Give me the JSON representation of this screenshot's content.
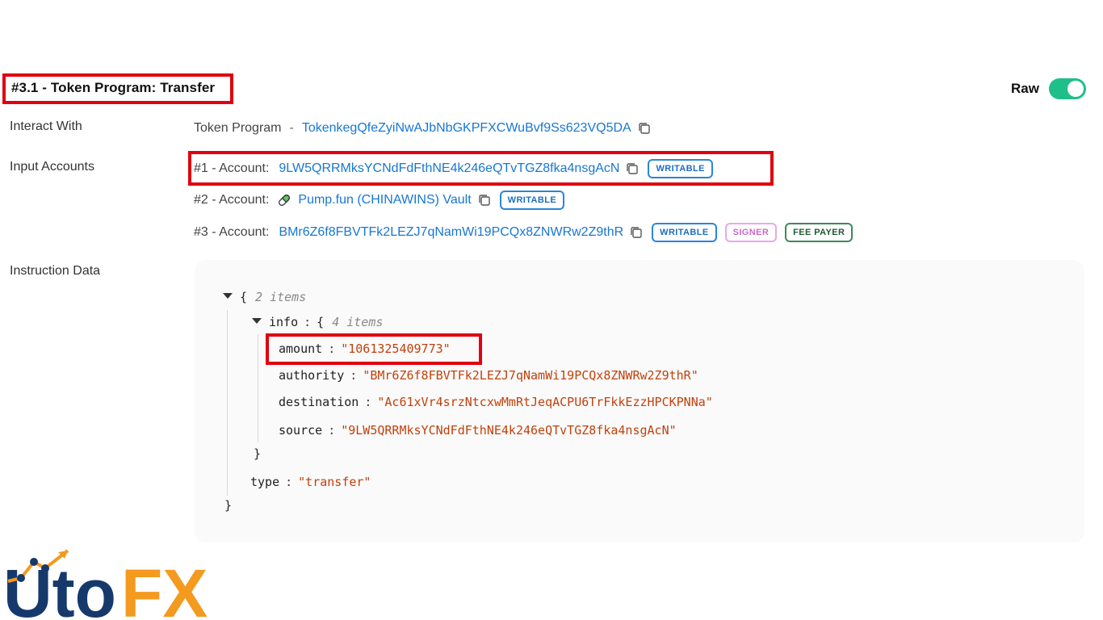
{
  "section": {
    "title": "#3.1 - Token Program: Transfer"
  },
  "raw": {
    "label": "Raw",
    "enabled": true
  },
  "rows": {
    "interact_label": "Interact With",
    "interact_program": "Token Program",
    "interact_sep": "-",
    "interact_address": "TokenkegQfeZyiNwAJbNbGKPFXCWuBvf9Ss623VQ5DA",
    "input_label": "Input Accounts",
    "data_label": "Instruction Data"
  },
  "accounts": [
    {
      "label": "#1 - Account:",
      "address": "9LW5QRRMksYCNdFdFthNE4k246eQTvTGZ8fka4nsgAcN",
      "badges": [
        "WRITABLE"
      ]
    },
    {
      "label": "#2 - Account:",
      "address": "Pump.fun (CHINAWINS) Vault",
      "badges": [
        "WRITABLE"
      ]
    },
    {
      "label": "#3 - Account:",
      "address": "BMr6Z6f8FBVTFk2LEZJ7qNamWi19PCQx8ZNWRw2Z9thR",
      "badges": [
        "WRITABLE",
        "SIGNER",
        "FEE PAYER"
      ]
    }
  ],
  "json": {
    "root_open": "{",
    "root_meta": "2 items",
    "info_key": "info",
    "info_open": "{",
    "info_meta": "4 items",
    "fields": [
      {
        "key": "amount",
        "value": "\"1061325409773\""
      },
      {
        "key": "authority",
        "value": "\"BMr6Z6f8FBVTFk2LEZJ7qNamWi19PCQx8ZNWRw2Z9thR\""
      },
      {
        "key": "destination",
        "value": "\"Ac61xVr4srzNtcxwMmRtJeqACPU6TrFkkEzzHPCKPNNa\""
      },
      {
        "key": "source",
        "value": "\"9LW5QRRMksYCNdFdFthNE4k246eQTvTGZ8fka4nsgAcN\""
      }
    ],
    "info_close": "}",
    "type_key": "type",
    "type_value": "\"transfer\"",
    "root_close": "}",
    "colon": ":"
  },
  "logo": {
    "text_left": "Uto",
    "text_right": "FX",
    "colors": {
      "blue": "#16396b",
      "orange": "#f39a1f"
    }
  },
  "colors": {
    "link": "#1877d2",
    "toggle": "#1fbf8a",
    "highlight": "#e0000f",
    "string": "#c2410c"
  }
}
